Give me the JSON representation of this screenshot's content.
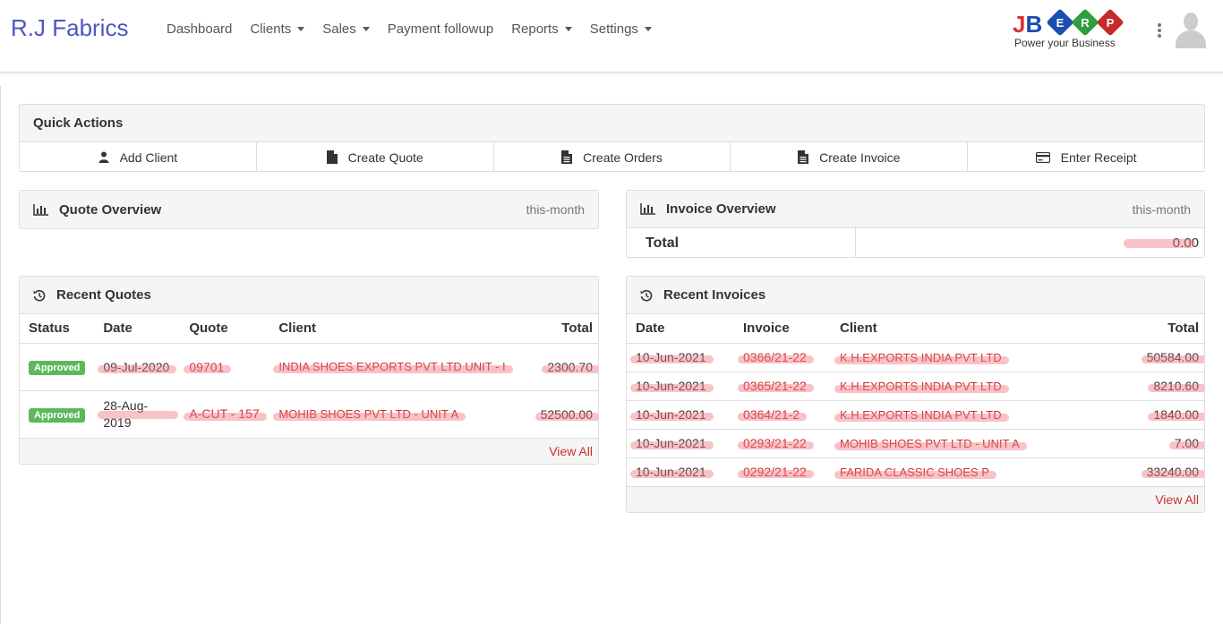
{
  "brand": "R.J Fabrics",
  "nav": [
    {
      "label": "Dashboard",
      "dropdown": false
    },
    {
      "label": "Clients",
      "dropdown": true
    },
    {
      "label": "Sales",
      "dropdown": true
    },
    {
      "label": "Payment followup",
      "dropdown": false
    },
    {
      "label": "Reports",
      "dropdown": true
    },
    {
      "label": "Settings",
      "dropdown": true
    }
  ],
  "logo": {
    "text": "JBERP",
    "tagline": "Power your Business"
  },
  "quick_actions": {
    "title": "Quick Actions",
    "buttons": [
      {
        "label": "Add Client",
        "icon": "user-icon"
      },
      {
        "label": "Create Quote",
        "icon": "file-icon"
      },
      {
        "label": "Create Orders",
        "icon": "file-text-icon"
      },
      {
        "label": "Create Invoice",
        "icon": "file-text-icon"
      },
      {
        "label": "Enter Receipt",
        "icon": "credit-card-icon"
      }
    ]
  },
  "quote_overview": {
    "title": "Quote Overview",
    "period": "this-month"
  },
  "invoice_overview": {
    "title": "Invoice Overview",
    "period": "this-month",
    "total_label": "Total",
    "total_value": "0.00"
  },
  "recent_quotes": {
    "title": "Recent Quotes",
    "columns": [
      "Status",
      "Date",
      "Quote",
      "Client",
      "Total"
    ],
    "rows": [
      {
        "status": "Approved",
        "date": "09-Jul-2020",
        "quote": "09701",
        "client": "INDIA SHOES EXPORTS PVT LTD UNIT - I",
        "total": "2300.70"
      },
      {
        "status": "Approved",
        "date": "28-Aug-2019",
        "quote": "A-CUT - 157",
        "client": "MOHIB SHOES PVT LTD - UNIT A",
        "total": "52500.00"
      }
    ],
    "view_all": "View All"
  },
  "recent_invoices": {
    "title": "Recent Invoices",
    "columns": [
      "Date",
      "Invoice",
      "Client",
      "Total"
    ],
    "rows": [
      {
        "date": "10-Jun-2021",
        "invoice": "0366/21-22",
        "client": "K.H.EXPORTS INDIA PVT LTD",
        "total": "50584.00"
      },
      {
        "date": "10-Jun-2021",
        "invoice": "0365/21-22",
        "client": "K.H.EXPORTS INDIA PVT LTD",
        "total": "8210.60"
      },
      {
        "date": "10-Jun-2021",
        "invoice": "0364/21-2",
        "client": "K.H.EXPORTS INDIA PVT LTD",
        "total": "1840.00"
      },
      {
        "date": "10-Jun-2021",
        "invoice": "0293/21-22",
        "client": "MOHIB SHOES PVT LTD - UNIT A",
        "total": "7.00"
      },
      {
        "date": "10-Jun-2021",
        "invoice": "0292/21-22",
        "client": "FARIDA CLASSIC SHOES P",
        "total": "33240.00"
      }
    ],
    "view_all": "View All"
  }
}
